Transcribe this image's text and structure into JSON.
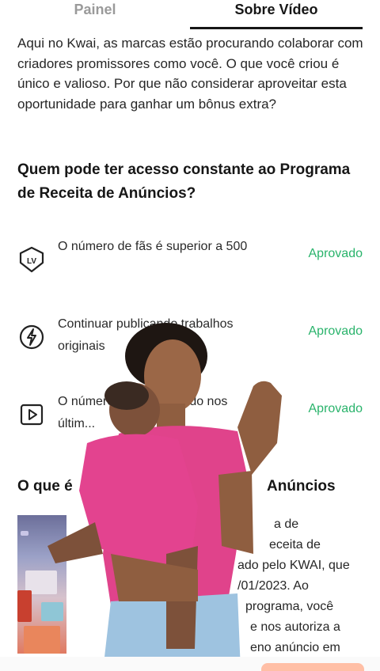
{
  "tabs": [
    {
      "label": "Painel",
      "active": false
    },
    {
      "label": "Sobre Vídeo",
      "active": true
    }
  ],
  "intro": "Aqui no Kwai, as marcas estão procurando colaborar com criadores promissores como você. O que você criou é único e valioso. Por que não considerar aproveitar esta oportunidade para ganhar um bônus extra?",
  "question_title": "Quem pode ter acesso constante ao Programa de Receita de Anúncios?",
  "requirements": [
    {
      "icon": "lv-level-icon",
      "text": "O número de fãs é superior a 500",
      "status": "Aprovado"
    },
    {
      "icon": "lightning-icon",
      "text": "Continuar publicando trabalhos originais",
      "status": "Aprovado"
    },
    {
      "icon": "play-video-icon",
      "text": "O número de ... publicado nos últim...",
      "status": "Aprovado"
    }
  ],
  "section2": {
    "title_left": "O que é",
    "title_right": "Anúncios"
  },
  "description_lines": [
    "a de",
    "eceita de",
    "ado pelo KWAI, que",
    "/01/2023. Ao",
    "programa, você",
    "e nos autoriza a",
    "eno anúncio em"
  ],
  "colors": {
    "approved": "#29b36b",
    "active_tab": "#161616",
    "inactive_tab": "#9a9a9a"
  }
}
